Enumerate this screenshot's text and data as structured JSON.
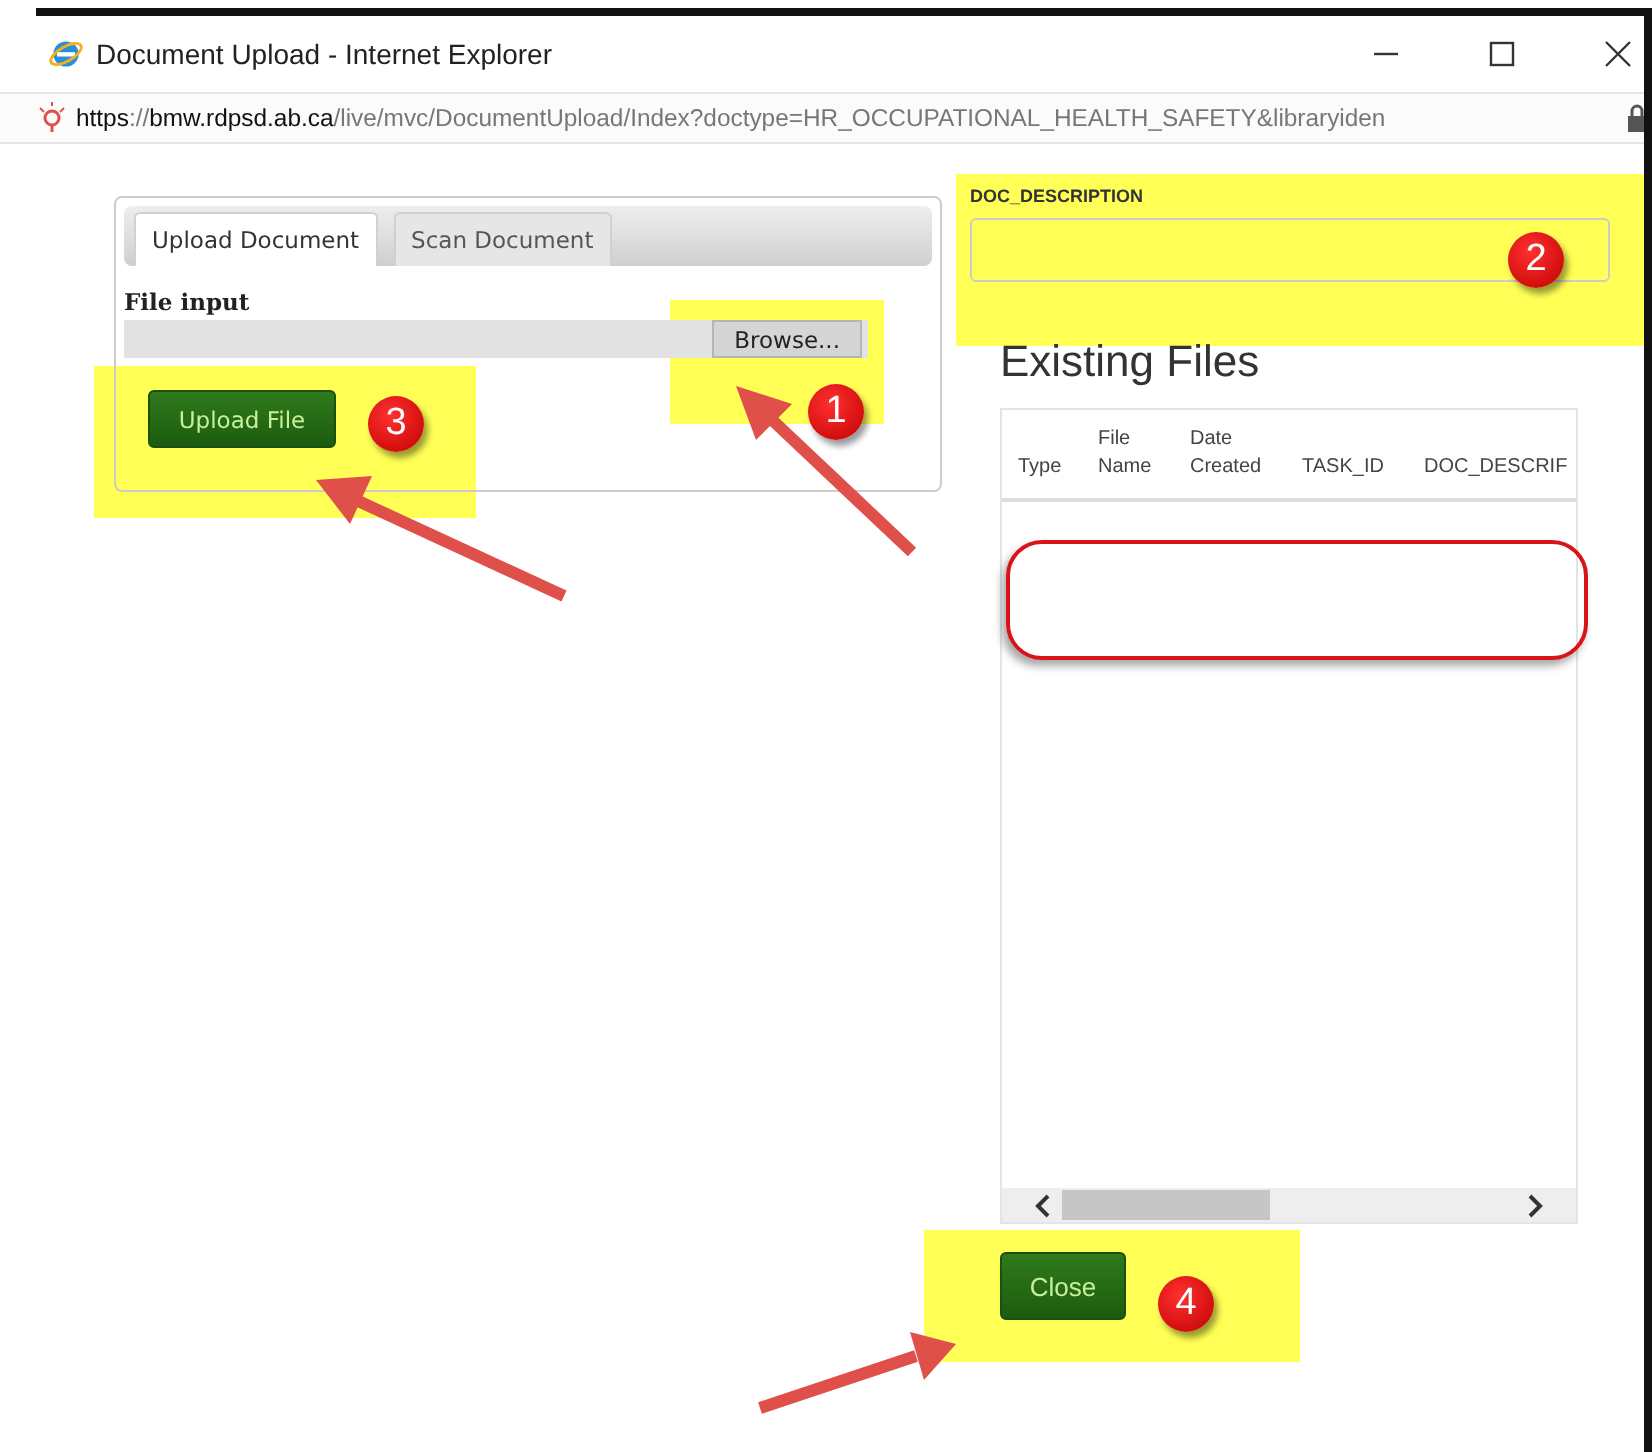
{
  "window": {
    "title": "Document Upload - Internet Explorer"
  },
  "address_bar": {
    "url": "**https**://**bmw.rdpsd.ab.ca**/live/mvc/DocumentUpload/Index?doctype=HR_OCCUPATIONAL_HEALTH_SAFETY&libraryiden"
  },
  "upload_panel": {
    "tabs": [
      {
        "label": "Upload Document",
        "selected": true
      },
      {
        "label": "Scan Document",
        "selected": false
      }
    ],
    "file_input_label": "File input",
    "browse_button": "Browse...",
    "upload_button": "Upload File"
  },
  "description": {
    "label": "DOC_DESCRIPTION"
  },
  "existing_files": {
    "title": "Existing Files",
    "columns": [
      "Type",
      "File Name",
      "Date Created",
      "TASK_ID",
      "DOC_DESCRIF"
    ]
  },
  "close_button": "Close",
  "annotations": [
    {
      "label": "1"
    },
    {
      "label": "2"
    },
    {
      "label": "3"
    },
    {
      "label": "4"
    }
  ]
}
